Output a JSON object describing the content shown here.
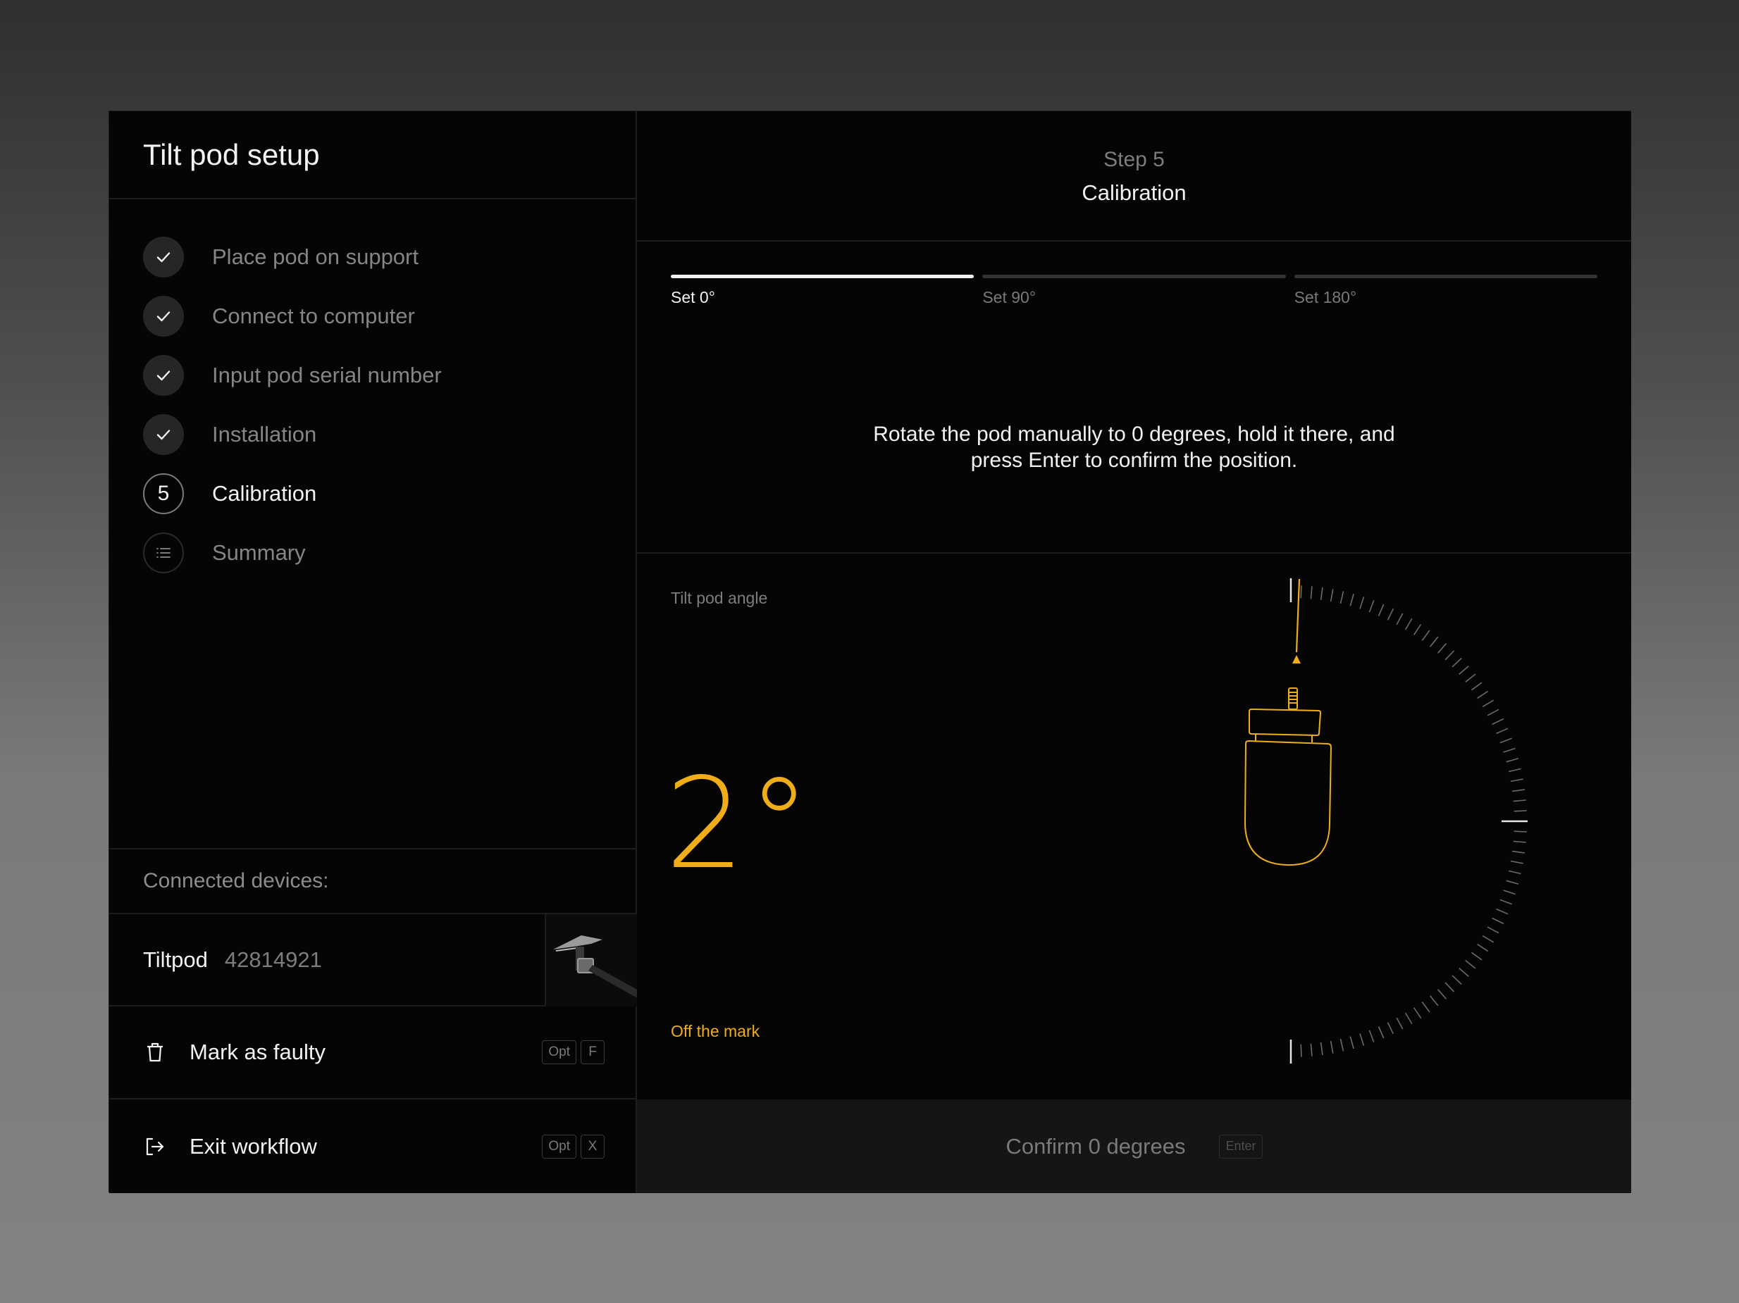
{
  "sidebar": {
    "title": "Tilt pod setup",
    "steps": [
      {
        "label": "Place pod on support",
        "state": "done",
        "badge": ""
      },
      {
        "label": "Connect to computer",
        "state": "done",
        "badge": ""
      },
      {
        "label": "Input pod serial number",
        "state": "done",
        "badge": ""
      },
      {
        "label": "Installation",
        "state": "done",
        "badge": ""
      },
      {
        "label": "Calibration",
        "state": "current",
        "badge": "5"
      },
      {
        "label": "Summary",
        "state": "todo",
        "badge": ""
      }
    ],
    "connected_label": "Connected devices:",
    "device": {
      "name": "Tiltpod",
      "serial": "42814921"
    },
    "actions": {
      "faulty": {
        "label": "Mark as faulty",
        "keys": [
          "Opt",
          "F"
        ]
      },
      "exit": {
        "label": "Exit workflow",
        "keys": [
          "Opt",
          "X"
        ]
      }
    }
  },
  "main": {
    "step_number": "Step 5",
    "step_name": "Calibration",
    "progress": [
      {
        "label": "Set 0°",
        "active": true
      },
      {
        "label": "Set 90°",
        "active": false
      },
      {
        "label": "Set 180°",
        "active": false
      }
    ],
    "instruction": "Rotate the pod manually to 0 degrees, hold it there, and press Enter to confirm the position.",
    "gauge": {
      "label": "Tilt pod angle",
      "angle": "2°",
      "status": "Off the mark",
      "accent": "#f0ad1a"
    },
    "confirm": {
      "label": "Confirm 0 degrees",
      "key": "Enter"
    }
  }
}
